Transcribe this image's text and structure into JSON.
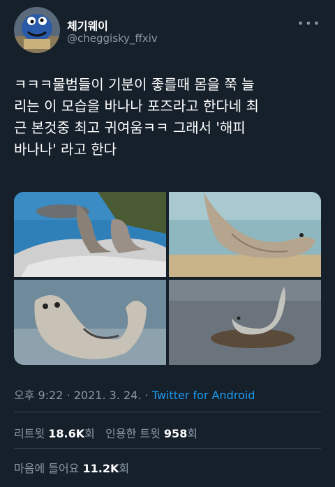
{
  "author": {
    "display_name": "체기웨이",
    "handle": "@cheggisky_ffxiv",
    "avatar_icon": "cookie-monster-avatar"
  },
  "menu_icon": "more-icon",
  "tweet": {
    "text": "ㅋㅋㅋ물범들이 기분이 좋를때 몸을 쭉 늘\n리는 이 모습을 바나나 포즈라고 한다네 최\n근 본것중 최고 귀여움ㅋㅋ 그래서 '해피\n바나나' 라고 한다"
  },
  "photos": [
    "seal-on-rock-photo",
    "seal-on-beach-photo",
    "seal-closeup-photo",
    "seal-on-stone-photo"
  ],
  "meta": {
    "time": "오후 9:22",
    "sep1": " · ",
    "date": "2021. 3. 24.",
    "sep2": " · ",
    "source": "Twitter for Android"
  },
  "stats": {
    "retweets_label": "리트윗",
    "retweets_count": "18.6K",
    "retweets_unit": "회",
    "quotes_label": "인용한 트윗",
    "quotes_count": "958",
    "quotes_unit": "회",
    "likes_label": "마음에 들어요",
    "likes_count": "11.2K",
    "likes_unit": "회"
  },
  "colors": {
    "background": "#15202b",
    "secondary_text": "#8b98a5",
    "link": "#1d9bf0",
    "divider": "#38444d"
  }
}
